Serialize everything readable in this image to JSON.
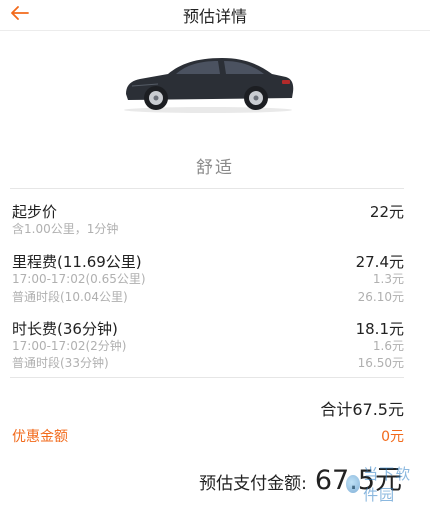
{
  "header": {
    "title": "预估详情",
    "back_icon": "arrow-left-icon",
    "accent_color": "#f26a1b"
  },
  "car": {
    "type_label": "舒适",
    "icon": "sedan-car-icon"
  },
  "fees": {
    "base": {
      "label": "起步价",
      "amount": "22元",
      "note": "含1.00公里，1分钟"
    },
    "mileage": {
      "label": "里程费(11.69公里)",
      "amount": "27.4元",
      "details": [
        {
          "label": "17:00-17:02(0.65公里)",
          "amount": "1.3元"
        },
        {
          "label": "普通时段(10.04公里)",
          "amount": "26.10元"
        }
      ]
    },
    "duration": {
      "label": "时长费(36分钟)",
      "amount": "18.1元",
      "details": [
        {
          "label": "17:00-17:02(2分钟)",
          "amount": "1.6元"
        },
        {
          "label": "普通时段(33分钟)",
          "amount": "16.50元"
        }
      ]
    }
  },
  "summary": {
    "total_label": "合计67.5元",
    "discount_label": "优惠金额",
    "discount_value": "0元",
    "pay_label": "预估支付金额",
    "pay_colon": ":",
    "pay_amount": "67.5元"
  },
  "watermark": {
    "text": "当下软件园"
  }
}
